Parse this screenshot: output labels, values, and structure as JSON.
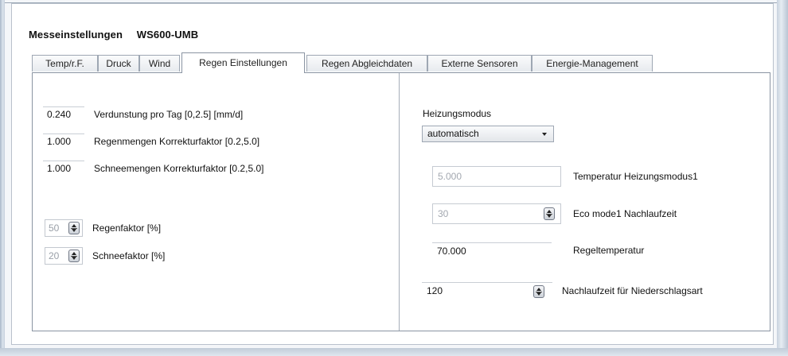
{
  "header": {
    "title": "Messeinstellungen",
    "model": "WS600-UMB"
  },
  "tabs": [
    {
      "label": "Temp/r.F.",
      "active": false
    },
    {
      "label": "Druck",
      "active": false
    },
    {
      "label": "Wind",
      "active": false
    },
    {
      "label": "Regen Einstellungen",
      "active": true
    },
    {
      "label": "Regen Abgleichdaten",
      "active": false
    },
    {
      "label": "Externe Sensoren",
      "active": false
    },
    {
      "label": "Energie-Management",
      "active": false
    }
  ],
  "left": {
    "fields": [
      {
        "value": "0.240",
        "label": "Verdunstung pro Tag [0,2.5] [mm/d]"
      },
      {
        "value": "1.000",
        "label": "Regenmengen Korrekturfaktor [0.2,5.0]"
      },
      {
        "value": "1.000",
        "label": "Schneemengen Korrekturfaktor [0.2,5.0]"
      }
    ],
    "spinners": [
      {
        "value": "50",
        "label": "Regenfaktor [%]"
      },
      {
        "value": "20",
        "label": "Schneefaktor [%]"
      }
    ]
  },
  "right": {
    "heating_label": "Heizungsmodus",
    "heating_value": "automatisch",
    "temp_mode_value": "5.000",
    "temp_mode_label": "Temperatur Heizungsmodus1",
    "eco_value": "30",
    "eco_label": "Eco mode1 Nachlaufzeit",
    "reg_value": "70.000",
    "reg_label": "Regeltemperatur",
    "nach_value": "120",
    "nach_label": "Nachlaufzeit für Niederschlagsart"
  }
}
